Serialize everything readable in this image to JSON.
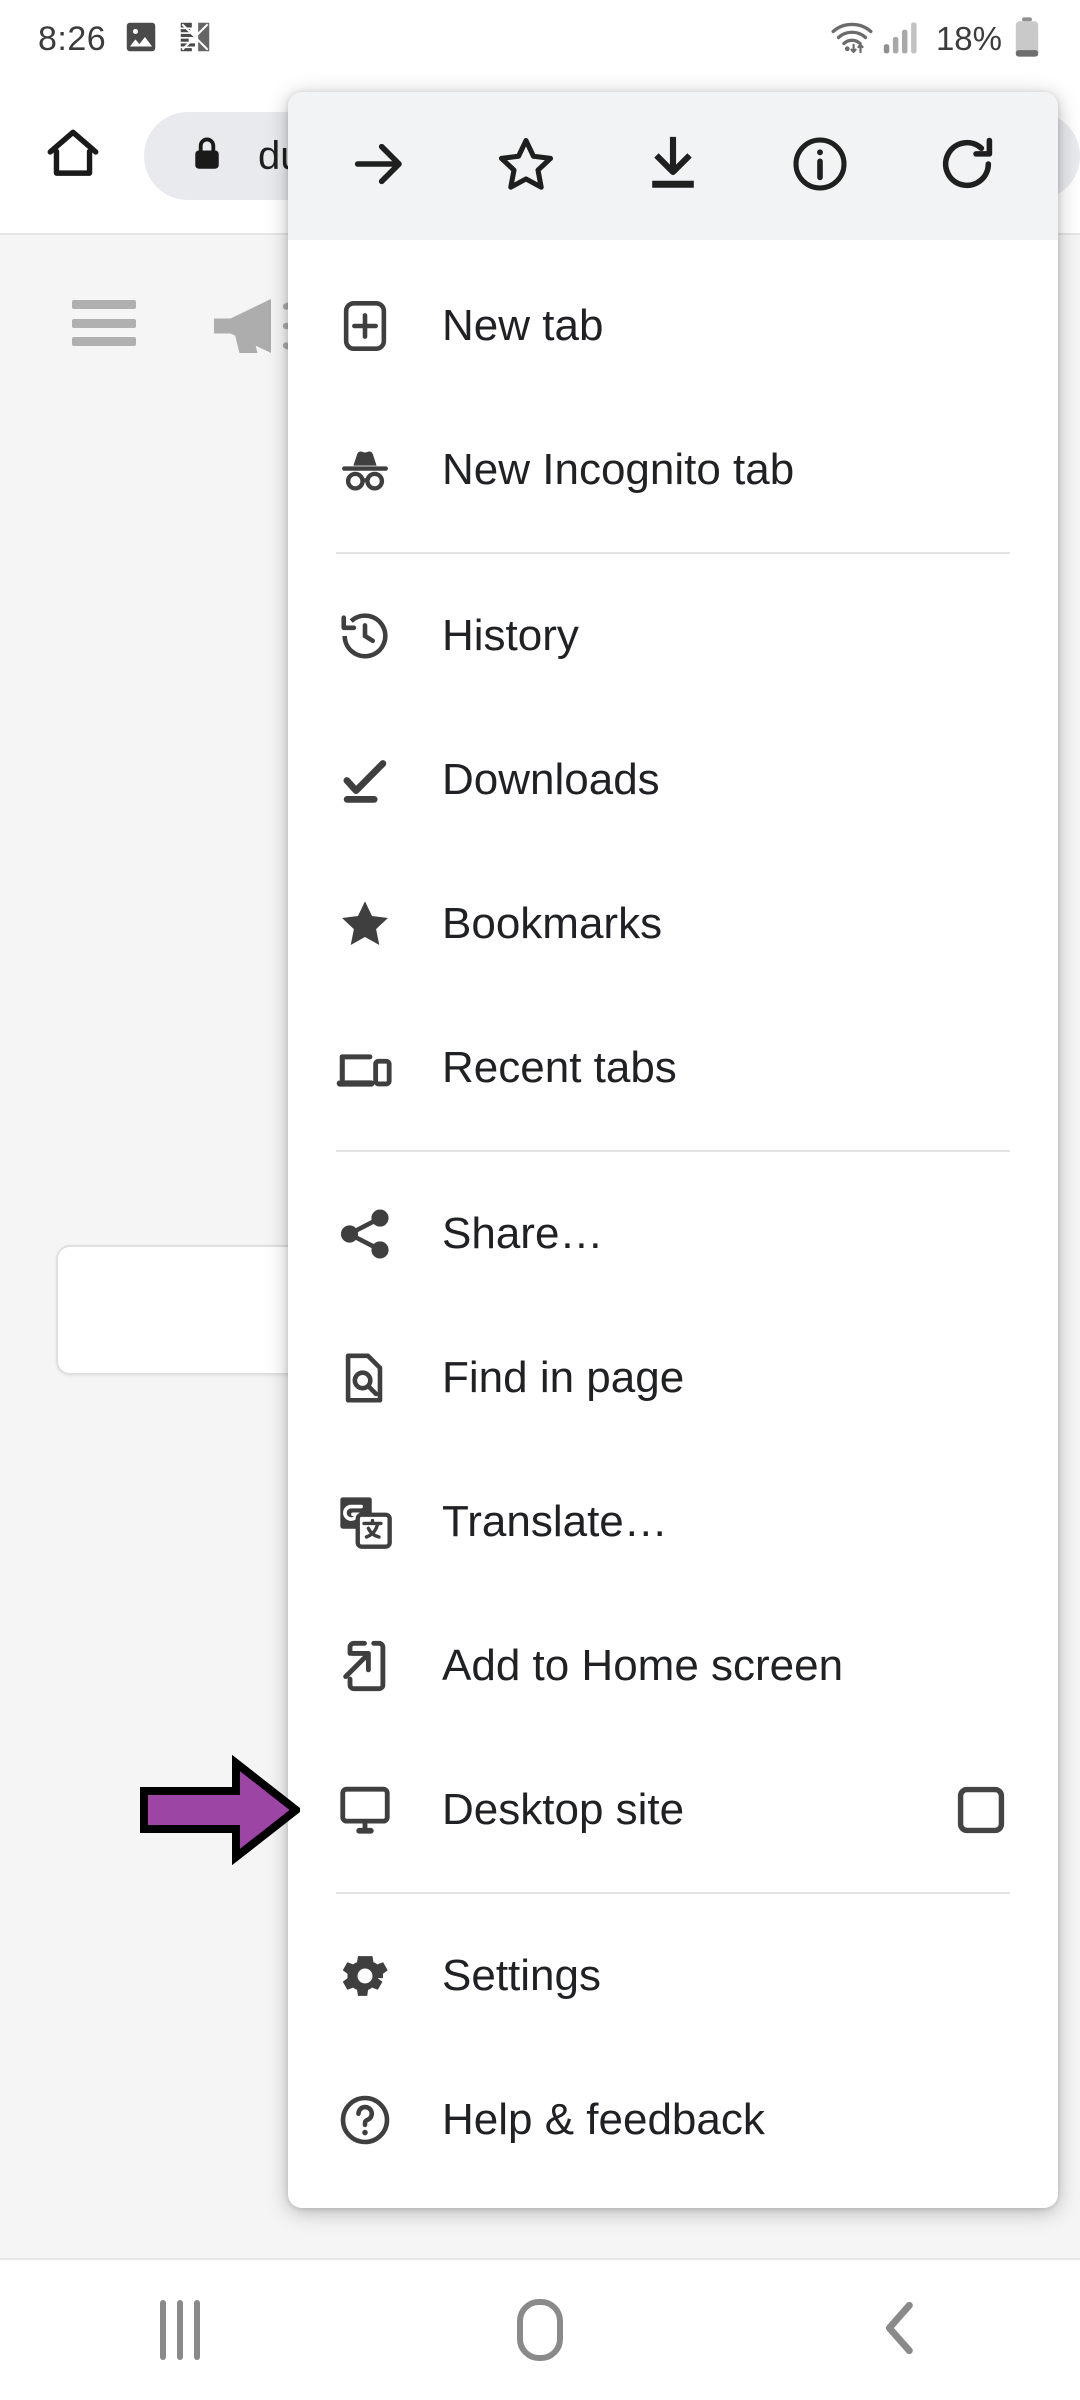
{
  "status_bar": {
    "time": "8:26",
    "battery_percent": "18%",
    "icons": [
      "gallery-icon",
      "app-icon",
      "wifi-icon",
      "cellular-signal-icon",
      "battery-icon"
    ]
  },
  "browser": {
    "home_icon": "home-icon",
    "lock_icon": "lock-icon",
    "url_text": "du",
    "page_icons": [
      "hamburger-menu-icon",
      "megaphone-icon"
    ]
  },
  "menu": {
    "toolbar": [
      {
        "name": "forward-button",
        "icon": "arrow-right-icon"
      },
      {
        "name": "bookmark-button",
        "icon": "star-outline-icon"
      },
      {
        "name": "download-button",
        "icon": "download-icon"
      },
      {
        "name": "page-info-button",
        "icon": "info-circle-icon"
      },
      {
        "name": "reload-button",
        "icon": "reload-icon"
      }
    ],
    "items": [
      {
        "label": "New tab",
        "icon": "new-tab-icon",
        "checkbox": false
      },
      {
        "label": "New Incognito tab",
        "icon": "incognito-icon",
        "checkbox": false
      },
      {
        "divider_after": true
      },
      {
        "label": "History",
        "icon": "history-icon",
        "checkbox": false
      },
      {
        "label": "Downloads",
        "icon": "downloads-icon",
        "checkbox": false
      },
      {
        "label": "Bookmarks",
        "icon": "star-filled-icon",
        "checkbox": false
      },
      {
        "label": "Recent tabs",
        "icon": "recent-tabs-icon",
        "checkbox": false
      },
      {
        "divider_after": true
      },
      {
        "label": "Share…",
        "icon": "share-icon",
        "checkbox": false
      },
      {
        "label": "Find in page",
        "icon": "find-in-page-icon",
        "checkbox": false
      },
      {
        "label": "Translate…",
        "icon": "translate-icon",
        "checkbox": false
      },
      {
        "label": "Add to Home screen",
        "icon": "add-to-home-screen-icon",
        "checkbox": false
      },
      {
        "label": "Desktop site",
        "icon": "desktop-site-icon",
        "checkbox": true,
        "checked": false
      },
      {
        "divider_after": true
      },
      {
        "label": "Settings",
        "icon": "gear-icon",
        "checkbox": false
      },
      {
        "label": "Help & feedback",
        "icon": "help-circle-icon",
        "checkbox": false
      }
    ],
    "labels": {
      "new_tab": "New tab",
      "new_incognito_tab": "New Incognito tab",
      "history": "History",
      "downloads": "Downloads",
      "bookmarks": "Bookmarks",
      "recent_tabs": "Recent tabs",
      "share": "Share…",
      "find_in_page": "Find in page",
      "translate": "Translate…",
      "add_to_home_screen": "Add to Home screen",
      "desktop_site": "Desktop site",
      "settings": "Settings",
      "help_feedback": "Help & feedback"
    }
  },
  "annotation": {
    "type": "arrow-right-annotation",
    "points_to": "Desktop site",
    "fill_color": "#9c45a4",
    "outline_color": "#000000"
  },
  "nav_bar": {
    "recents_label": "recents-icon",
    "home_label": "home-icon",
    "back_label": "back-icon"
  },
  "colors": {
    "menu_background": "#ffffff",
    "menu_toolbar_background": "#f1f3f4",
    "page_background": "#f5f5f5",
    "omnibox_background": "#e8eaed",
    "text_primary": "#202124",
    "icon_color": "#3f3f3f",
    "accent_purple": "#9c45a4"
  }
}
